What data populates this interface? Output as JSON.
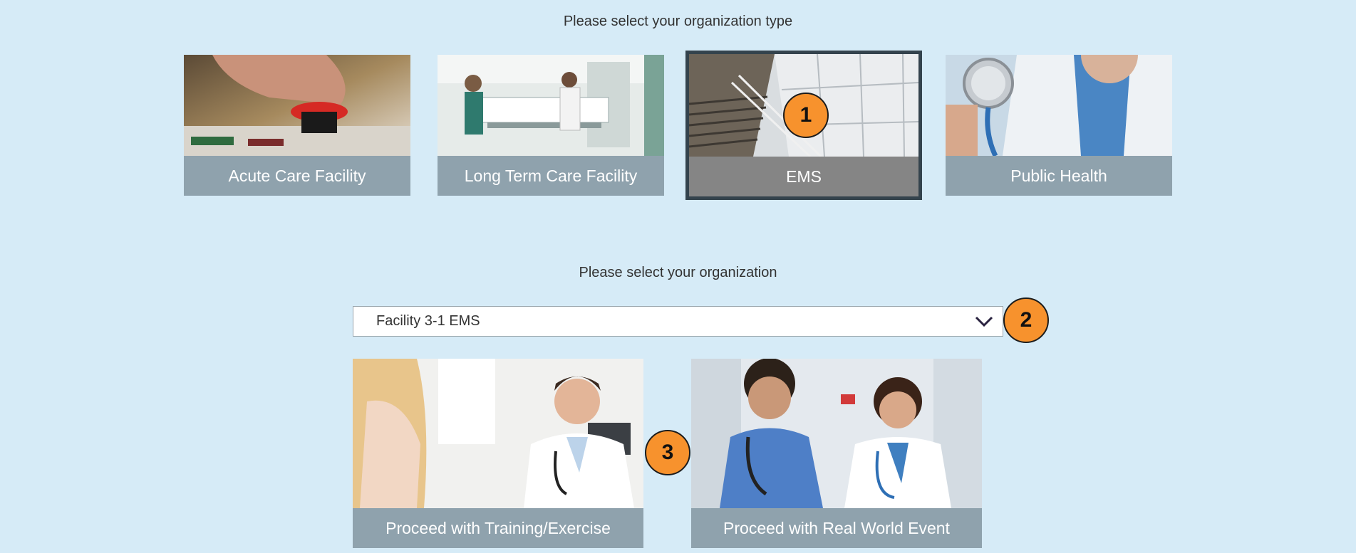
{
  "org_type_section": {
    "heading": "Please select your organization type",
    "cards": [
      {
        "label": "Acute Care Facility",
        "selected": false
      },
      {
        "label": "Long Term Care Facility",
        "selected": false
      },
      {
        "label": "EMS",
        "selected": true
      },
      {
        "label": "Public Health",
        "selected": false
      }
    ]
  },
  "org_section": {
    "heading": "Please select your organization",
    "select_value": "Facility 3-1 EMS"
  },
  "proceed": {
    "training_label": "Proceed with Training/Exercise",
    "real_world_label": "Proceed with Real World Event"
  },
  "badges": {
    "one": "1",
    "two": "2",
    "three": "3"
  },
  "colors": {
    "background": "#d6ebf7",
    "card_label": "#8fa2ad",
    "selected_label": "#858585",
    "selected_border": "#34434d",
    "badge": "#f7922d"
  }
}
